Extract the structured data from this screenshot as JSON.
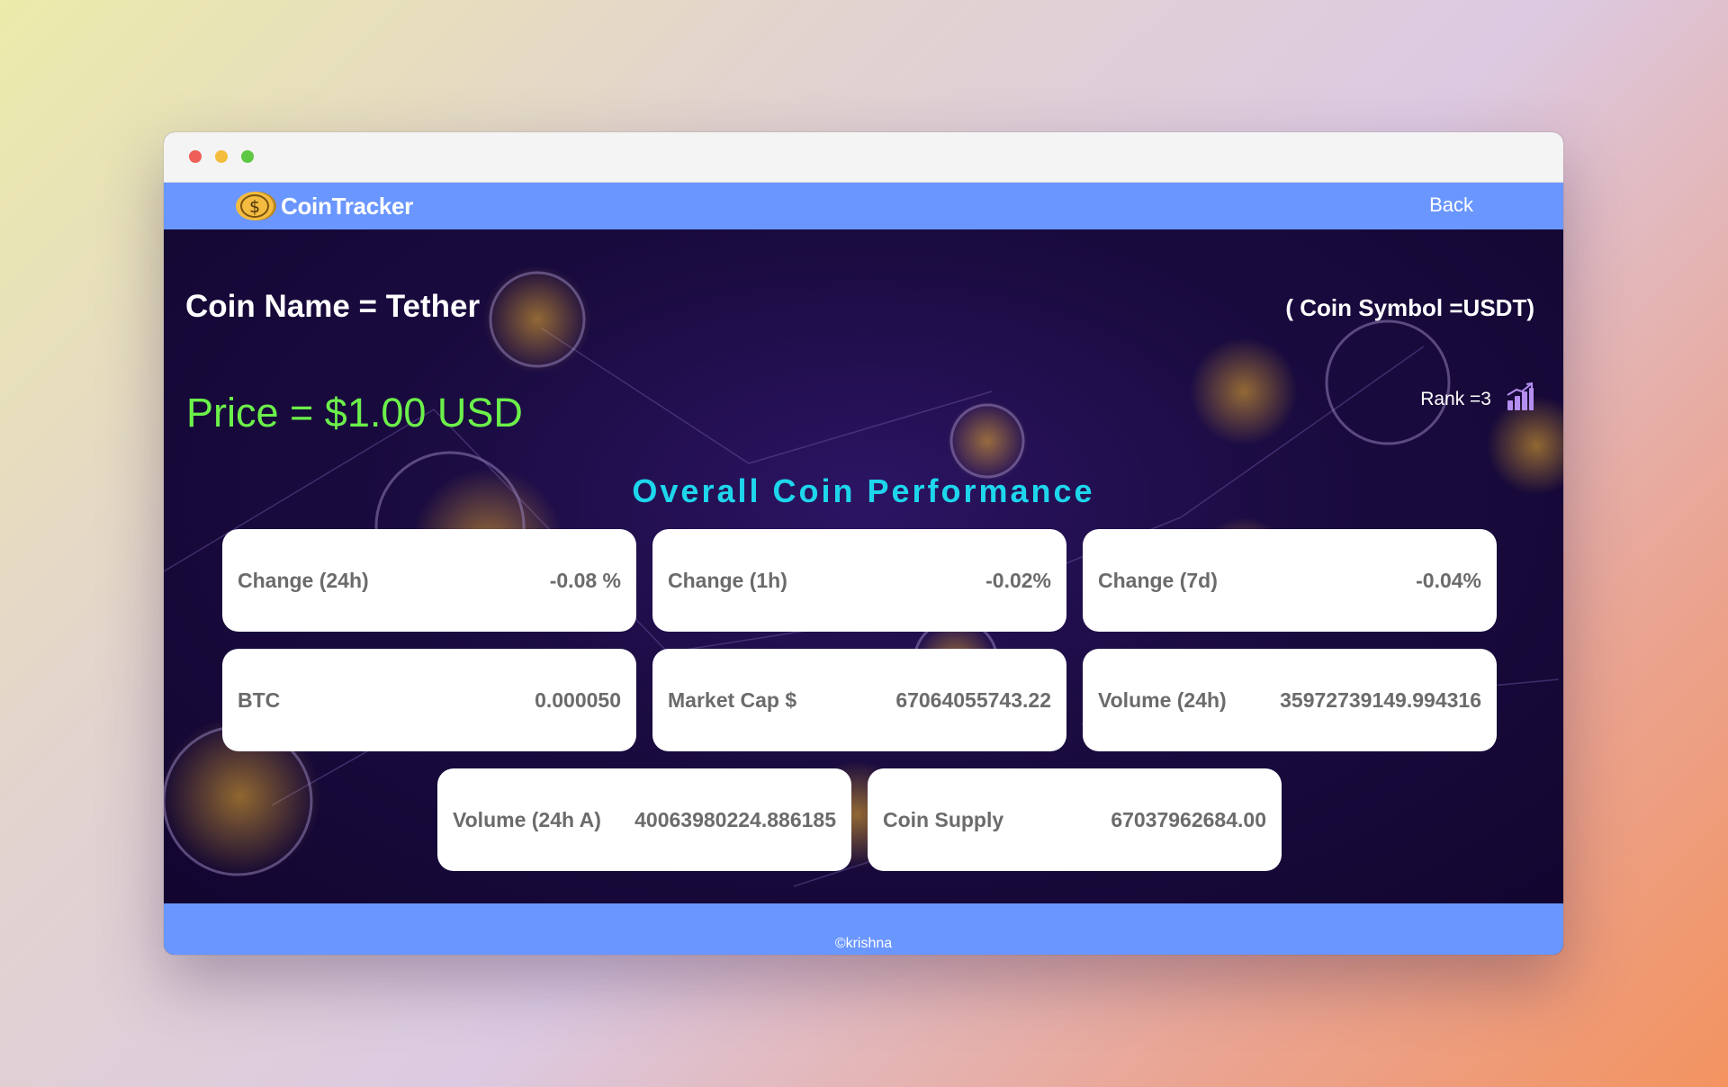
{
  "navbar": {
    "brand": "CoinTracker",
    "back_label": "Back"
  },
  "coin": {
    "name_line": "Coin Name = Tether",
    "symbol_line": "( Coin Symbol =USDT)",
    "price_line": "Price = $1.00 USD",
    "rank_line": "Rank =3"
  },
  "performance": {
    "title": "Overall Coin Performance",
    "cards": [
      {
        "label": "Change (24h)",
        "value": "-0.08 %"
      },
      {
        "label": "Change (1h)",
        "value": "-0.02%"
      },
      {
        "label": "Change (7d)",
        "value": "-0.04%"
      },
      {
        "label": "BTC",
        "value": "0.000050"
      },
      {
        "label": "Market Cap $",
        "value": "67064055743.22"
      },
      {
        "label": "Volume (24h)",
        "value": "35972739149.994316"
      },
      {
        "label": "Volume (24h A)",
        "value": "40063980224.886185"
      },
      {
        "label": "Coin Supply",
        "value": "67037962684.00"
      }
    ]
  },
  "footer": {
    "copyright": "©krishna"
  },
  "icons": {
    "logo": "dollar-coin-icon",
    "rank": "bar-chart-trend-icon"
  },
  "colors": {
    "navbar": "#6a96ff",
    "price": "#6cf04a",
    "section_title": "#1ed6ec",
    "card_text": "#6b6b6b",
    "rank_icon": "#b48ef0"
  }
}
